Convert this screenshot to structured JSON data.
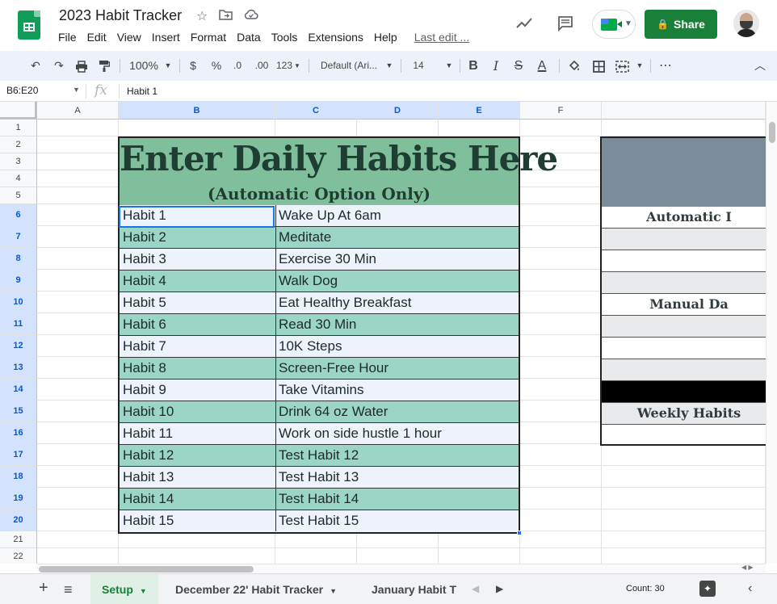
{
  "document": {
    "title": "2023 Habit Tracker",
    "last_edit": "Last edit ..."
  },
  "menu": [
    "File",
    "Edit",
    "View",
    "Insert",
    "Format",
    "Data",
    "Tools",
    "Extensions",
    "Help"
  ],
  "header_actions": {
    "share_label": "Share",
    "icons": [
      "star-icon",
      "move-to-folder-icon",
      "cloud-status-icon",
      "trend-icon",
      "comments-icon",
      "meet-icon",
      "lock-icon"
    ]
  },
  "toolbar": {
    "zoom": "100%",
    "currency": "$",
    "percent": "%",
    "decrease_decimal": ".0",
    "increase_decimal": ".00",
    "number_format": "123",
    "font_family": "Default (Ari...",
    "font_size": "14",
    "bold": "B",
    "italic": "I",
    "strikethrough": "S",
    "text_color": "A",
    "more": "⋯"
  },
  "formula_bar": {
    "name_box": "B6:E20",
    "fx": "fx",
    "content": "Habit 1"
  },
  "columns": [
    {
      "label": "A"
    },
    {
      "label": "B"
    },
    {
      "label": "C"
    },
    {
      "label": "D"
    },
    {
      "label": "E"
    },
    {
      "label": "F"
    },
    {
      "label": ""
    }
  ],
  "rows": [
    "1",
    "2",
    "3",
    "4",
    "5",
    "6",
    "7",
    "8",
    "9",
    "10",
    "11",
    "12",
    "13",
    "14",
    "15",
    "16",
    "17",
    "18",
    "19",
    "20",
    "21",
    "22"
  ],
  "banner": {
    "title": "Enter Daily Habits Here",
    "subtitle": "(Automatic Option Only)"
  },
  "habits": [
    {
      "key": "Habit 1",
      "value": "Wake Up At 6am"
    },
    {
      "key": "Habit 2",
      "value": "Meditate"
    },
    {
      "key": "Habit 3",
      "value": "Exercise 30 Min"
    },
    {
      "key": "Habit 4",
      "value": "Walk Dog"
    },
    {
      "key": "Habit 5",
      "value": "Eat Healthy Breakfast"
    },
    {
      "key": "Habit 6",
      "value": "Read 30 Min"
    },
    {
      "key": "Habit 7",
      "value": "10K Steps"
    },
    {
      "key": "Habit 8",
      "value": "Screen-Free Hour"
    },
    {
      "key": "Habit 9",
      "value": "Take Vitamins"
    },
    {
      "key": "Habit 10",
      "value": "Drink 64 oz Water"
    },
    {
      "key": "Habit 11",
      "value": "Work on side hustle 1 hour"
    },
    {
      "key": "Habit 12",
      "value": "Test Habit 12"
    },
    {
      "key": "Habit 13",
      "value": "Test Habit 13"
    },
    {
      "key": "Habit 14",
      "value": "Test Habit 14"
    },
    {
      "key": "Habit 15",
      "value": "Test Habit 15"
    }
  ],
  "right_panel": {
    "automatic_label": "Automatic I",
    "manual_label": "Manual Da",
    "weekly_label": "Weekly Habits"
  },
  "sheet_tabs": [
    {
      "label": "Setup",
      "active": true
    },
    {
      "label": "December 22' Habit Tracker",
      "active": false
    },
    {
      "label": "January Habit T",
      "active": false
    }
  ],
  "status": {
    "count": "Count: 30"
  },
  "colors": {
    "brand_green": "#188038",
    "banner_green": "#7fbf9c",
    "row_teal": "#9bd5c6",
    "row_light": "#eef2fb",
    "panel_header": "#7a8e9a",
    "selection_blue": "#1a73e8"
  }
}
